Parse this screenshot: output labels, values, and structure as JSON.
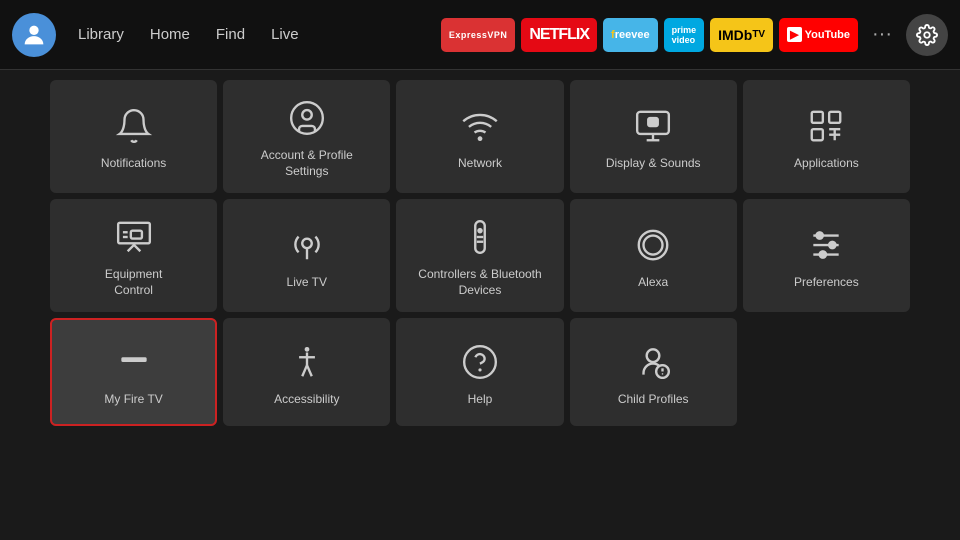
{
  "nav": {
    "library": "Library",
    "home": "Home",
    "find": "Find",
    "live": "Live"
  },
  "apps": [
    {
      "id": "expressvpn",
      "label": "ExpressVPN",
      "class": "badge-expressvpn"
    },
    {
      "id": "netflix",
      "label": "NETFLIX",
      "class": "badge-netflix"
    },
    {
      "id": "freevee",
      "label": "freevee",
      "class": "badge-freevee"
    },
    {
      "id": "prime",
      "label": "prime video",
      "class": "badge-prime"
    },
    {
      "id": "imdb",
      "label": "IMDb TV",
      "class": "badge-imdb"
    },
    {
      "id": "youtube",
      "label": "▶ YouTube",
      "class": "badge-youtube"
    }
  ],
  "grid": {
    "items": [
      {
        "id": "notifications",
        "label": "Notifications",
        "icon": "bell"
      },
      {
        "id": "account-profile",
        "label": "Account & Profile Settings",
        "icon": "user-circle"
      },
      {
        "id": "network",
        "label": "Network",
        "icon": "wifi"
      },
      {
        "id": "display-sounds",
        "label": "Display & Sounds",
        "icon": "display"
      },
      {
        "id": "applications",
        "label": "Applications",
        "icon": "apps"
      },
      {
        "id": "equipment-control",
        "label": "Equipment Control",
        "icon": "monitor"
      },
      {
        "id": "live-tv",
        "label": "Live TV",
        "icon": "antenna"
      },
      {
        "id": "controllers-bluetooth",
        "label": "Controllers & Bluetooth Devices",
        "icon": "remote"
      },
      {
        "id": "alexa",
        "label": "Alexa",
        "icon": "alexa"
      },
      {
        "id": "preferences",
        "label": "Preferences",
        "icon": "sliders"
      },
      {
        "id": "my-fire-tv",
        "label": "My Fire TV",
        "icon": "firetv",
        "selected": true
      },
      {
        "id": "accessibility",
        "label": "Accessibility",
        "icon": "accessibility"
      },
      {
        "id": "help",
        "label": "Help",
        "icon": "help"
      },
      {
        "id": "child-profiles",
        "label": "Child Profiles",
        "icon": "child"
      }
    ]
  }
}
